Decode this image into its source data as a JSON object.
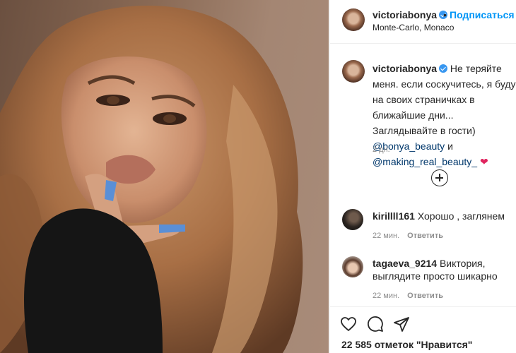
{
  "post": {
    "author": "victoriabonya",
    "location": "Monte-Carlo, Monaco",
    "follow_label": "Подписаться",
    "dot": "•"
  },
  "caption": {
    "username": "victoriabonya",
    "text_line1": "Не теряйте меня.",
    "text_rest": "если соскучитесь, я буду на своих страничках в ближайшие дни... Заглядывайте в гости)",
    "mention1": "@bonya_beauty",
    "and_word": "и",
    "mention2": "@making_real_beauty_",
    "emoji": "❤",
    "time": "2 дн."
  },
  "comments": [
    {
      "username": "kirillll161",
      "text": "Хорошо , заглянем",
      "time": "22 мин.",
      "reply_label": "Ответить"
    },
    {
      "username": "tagaeva_9214",
      "text": "Виктория, выглядите просто шикарно",
      "time": "22 мин.",
      "reply_label": "Ответить"
    }
  ],
  "actions": {
    "like_icon": "heart-icon",
    "comment_icon": "comment-icon",
    "share_icon": "share-icon"
  },
  "likes_text": "22 585 отметок \"Нравится\"",
  "colors": {
    "accent": "#0095f6",
    "verified": "#3897f0",
    "mention": "#00376b",
    "muted": "#8e8e8e",
    "emoji_heart": "#e0245e"
  }
}
